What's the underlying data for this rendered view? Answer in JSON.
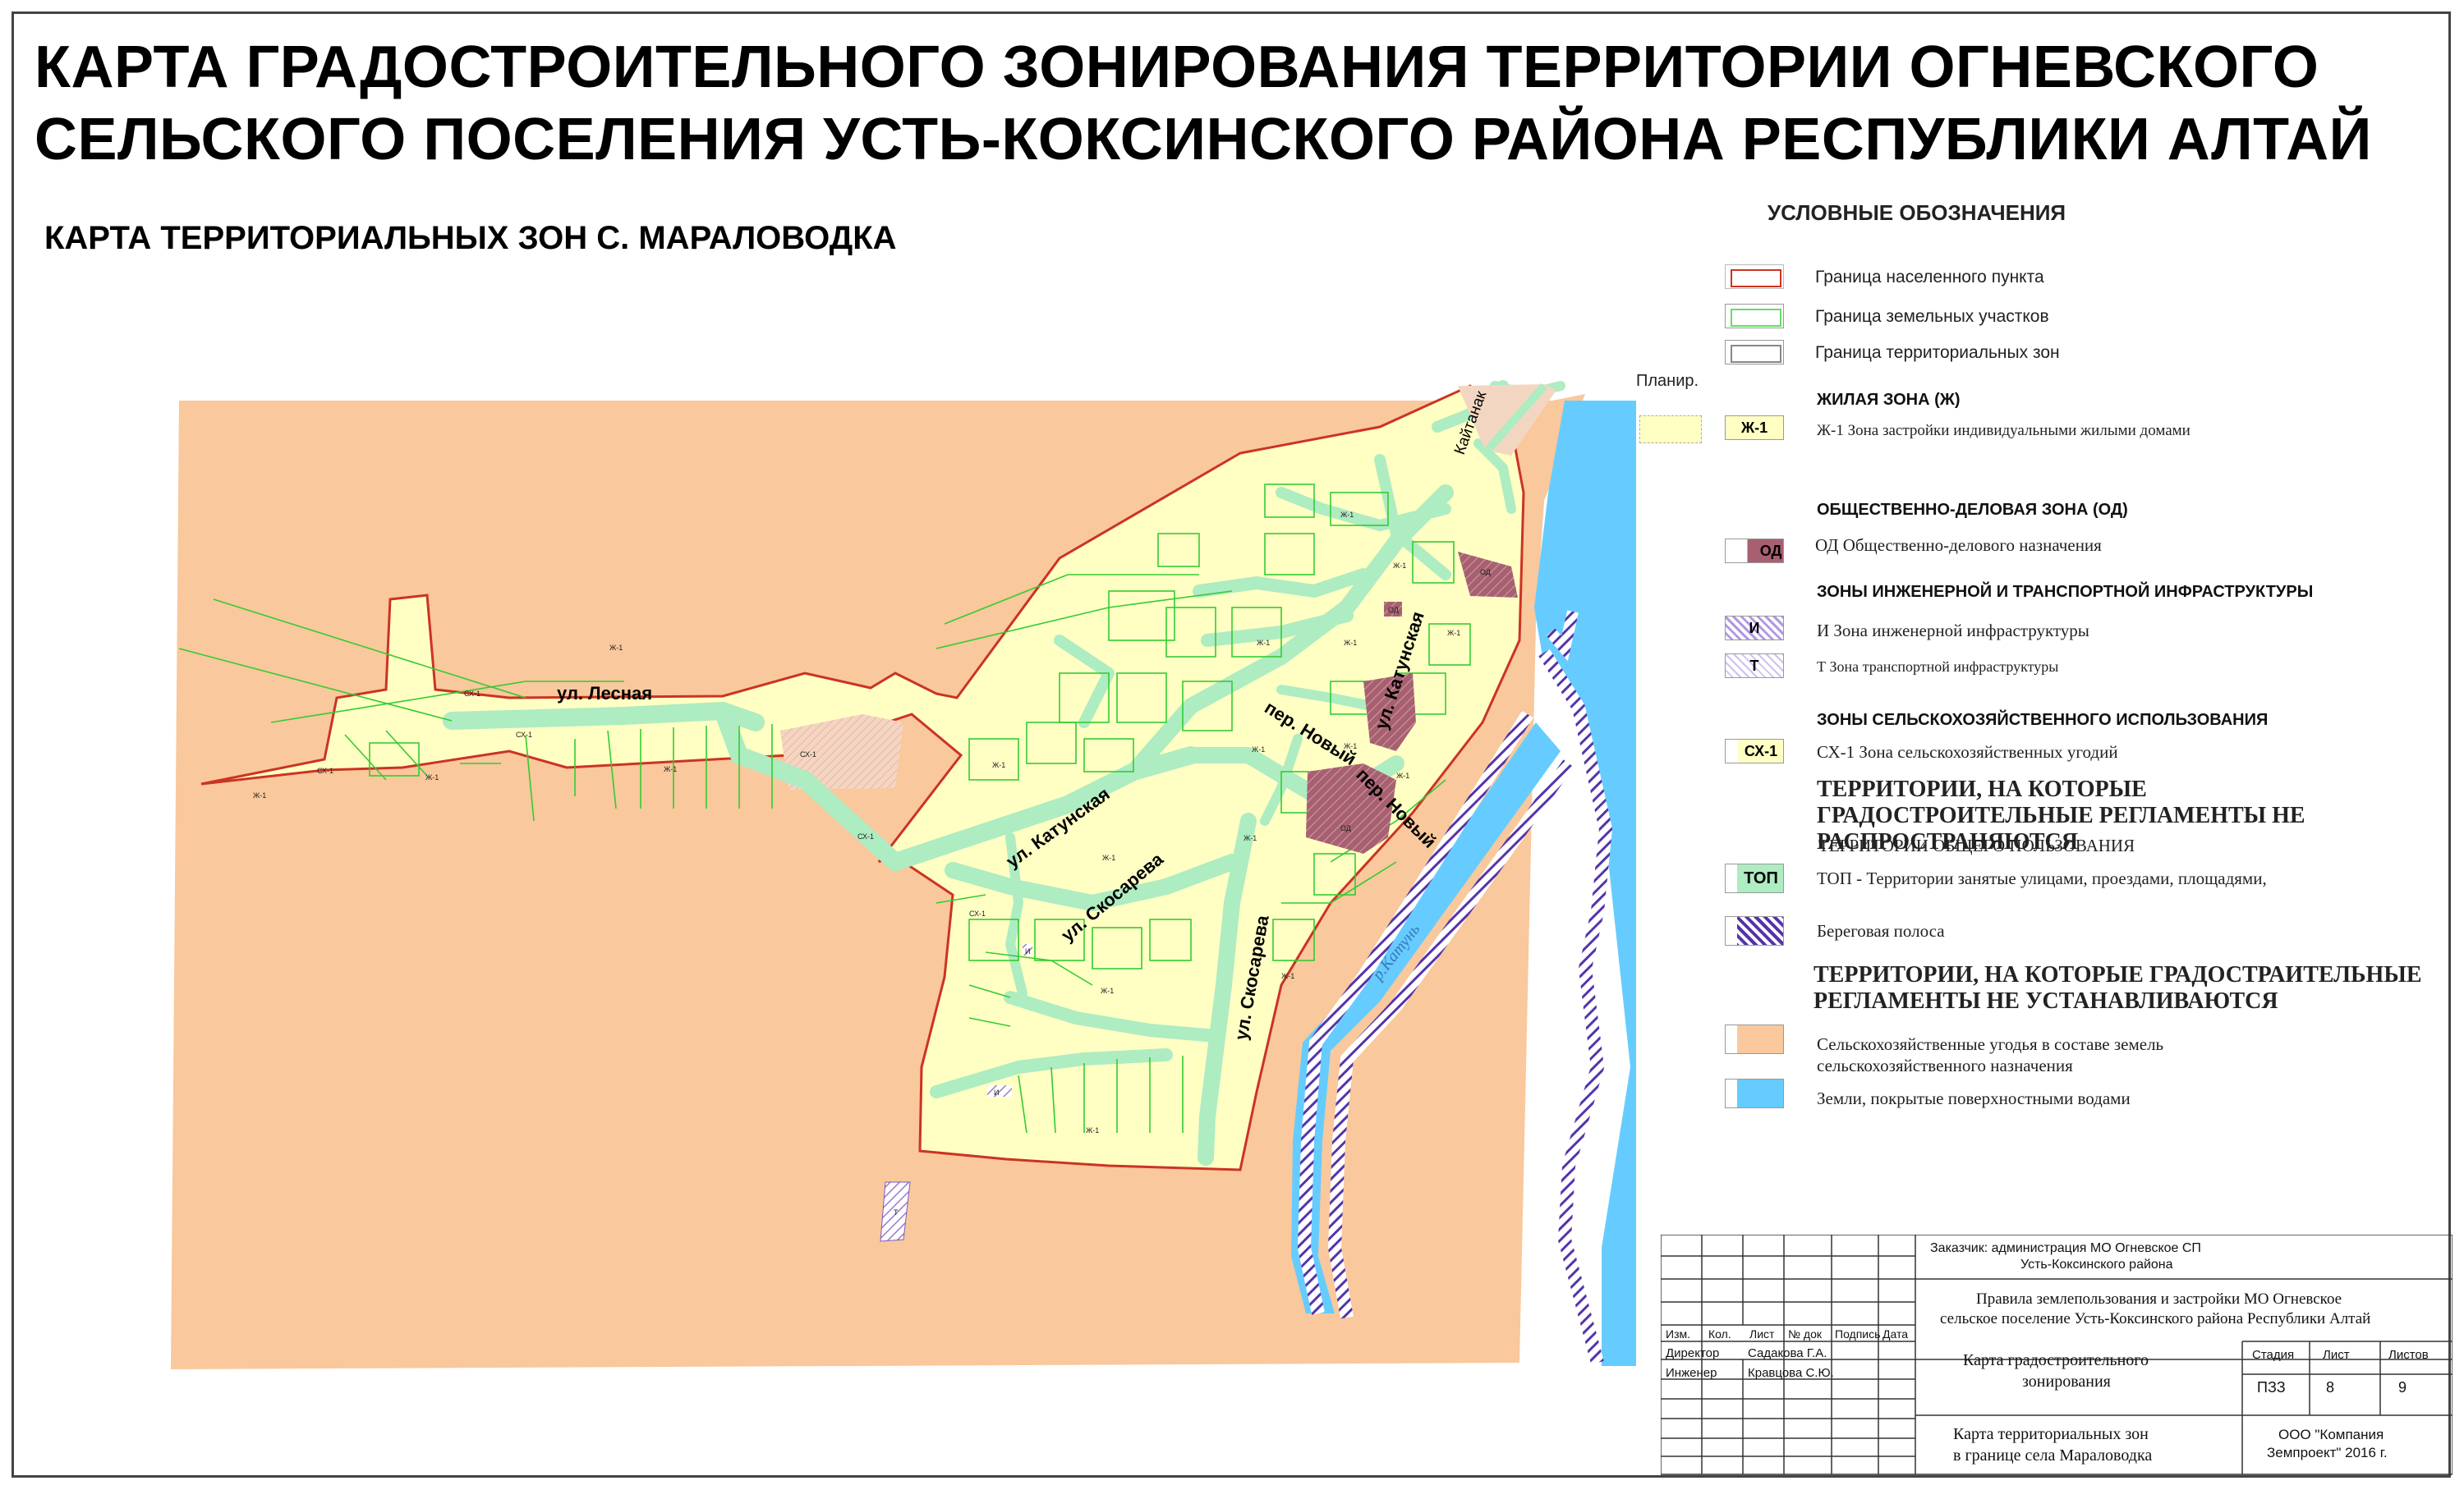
{
  "header": {
    "title_line1": "КАРТА ГРАДОСТРОИТЕЛЬНОГО ЗОНИРОВАНИЯ ТЕРРИТОРИИ ОГНЕВСКОГО",
    "title_line2": "СЕЛЬСКОГО ПОСЕЛЕНИЯ УСТЬ-КОКСИНСКОГО РАЙОНА РЕСПУБЛИКИ АЛТАЙ",
    "subtitle": "КАРТА ТЕРРИТОРИАЛЬНЫХ ЗОН С. МАРАЛОВОДКА"
  },
  "colors": {
    "agri_land": "#f9c89c",
    "residential": "#ffffc4",
    "water": "#66ccff",
    "roads": "#aeecc2",
    "plots": "#33cc33",
    "boundary": "#cc3322",
    "public_business": "#a86070",
    "shore": "#5533aa"
  },
  "map": {
    "streets": {
      "lesnaya": "ул. Лесная",
      "katunskaya_w": "ул. Катунская",
      "katunskaya_n": "ул. Катунская",
      "skosareva_w": "ул. Скосарева",
      "skosareva_s": "ул. Скосарева",
      "noviy1": "пер. Новый",
      "noviy2": "пер. Новый"
    },
    "places": {
      "kaitanak": "Кайтанак",
      "planir": "Планир."
    },
    "river": "р.Катунь",
    "zone_labels": [
      "Ж-1",
      "Ж-1",
      "Ж-1",
      "Ж-1",
      "Ж-1",
      "Ж-1",
      "Ж-1",
      "Ж-1",
      "Ж-1",
      "Ж-1",
      "Ж-1",
      "Ж-1",
      "Ж-1",
      "Ж-1",
      "Ж-1",
      "Ж-1",
      "Ж-1",
      "Ж-1",
      "СХ-1",
      "СХ-1",
      "СХ-1",
      "СХ-1",
      "СХ-1",
      "СХ-1",
      "ОД",
      "ОД",
      "ОД",
      "И",
      "И",
      "Т"
    ]
  },
  "legend": {
    "title": "УСЛОВНЫЕ ОБОЗНАЧЕНИЯ",
    "boundary_settlement": "Граница населенного пункта",
    "boundary_plots": "Граница земельных участков",
    "boundary_zones": "Граница территориальных зон",
    "residential_head": "ЖИЛАЯ ЗОНА (Ж)",
    "zh1_code": "Ж-1",
    "zh1_text": "Ж-1   Зона застройки индивидуальными жилыми домами",
    "od_head": "ОБЩЕСТВЕННО-ДЕЛОВАЯ ЗОНА (ОД)",
    "od_code": "ОД",
    "od_text": "ОД   Общественно-делового назначения",
    "infra_head": "ЗОНЫ ИНЖЕНЕРНОЙ И ТРАНСПОРТНОЙ ИНФРАСТРУКТУРЫ",
    "i_code": "И",
    "i_text": "И      Зона  инженерной инфраструктуры",
    "t_code": "Т",
    "t_text": "Т     Зона транспортной инфраструктуры",
    "agri_head": "ЗОНЫ СЕЛЬСКОХОЗЯЙСТВЕННОГО ИСПОЛЬЗОВАНИЯ",
    "sh1_code": "СХ-1",
    "sh1_text": "СХ-1   Зона сельскохозяйственных угодий",
    "not_apply_head": "ТЕРРИТОРИИ, НА КОТОРЫЕ ГРАДОСТРОИТЕЛЬНЫЕ РЕГЛАМЕНТЫ НЕ РАСПРОСТРАНЯЮТСЯ",
    "public_use": "ТЕРРИТОРИИ ОБЩЕГО ПОЛЬЗОВАНИЯ",
    "top_code": "ТОП",
    "top_text": "ТОП  -  Территории занятые улицами, проездами, площадями,",
    "shore": "Береговая полоса",
    "not_set_head": "ТЕРРИТОРИИ, НА КОТОРЫЕ ГРАДОСТРАИТЕЛЬНЫЕ РЕГЛАМЕНТЫ НЕ УСТАНАВЛИВАЮТСЯ",
    "agri_land_1": "Сельскохозяйственные угодья в составе земель",
    "agri_land_2": "сельскохозяйственного назначения",
    "water": "Земли, покрытые поверхностными водами"
  },
  "stamp": {
    "customer_1": "Заказчик: администрация МО Огневское СП",
    "customer_2": "Усть-Коксинского района",
    "project_1": "Правила землепользования и застройки  МО Огневское",
    "project_2": "сельское поселение Усть-Коксинского района Республики Алтай",
    "col_izm": "Изм.",
    "col_kol": "Кол.",
    "col_list": "Лист",
    "col_ndok": "№ док",
    "col_podpis": "Подпись",
    "col_data": "Дата",
    "role_1": "Директор",
    "name_1": "Садакова Г.А.",
    "role_2": "Инженер",
    "name_2": "Кравцова С.Ю.",
    "doc_1": "Карта градостроительного",
    "doc_2": "зонирования",
    "stadia_label": "Стадия",
    "list_label": "Лист",
    "listov_label": "Листов",
    "stadia": "ПЗЗ",
    "list": "8",
    "listov": "9",
    "sheet_1": "Карта территориальных зон",
    "sheet_2": "в границе села Мараловодка",
    "company_1": "ООО \"Компания",
    "company_2": "Земпроект\" 2016 г."
  }
}
